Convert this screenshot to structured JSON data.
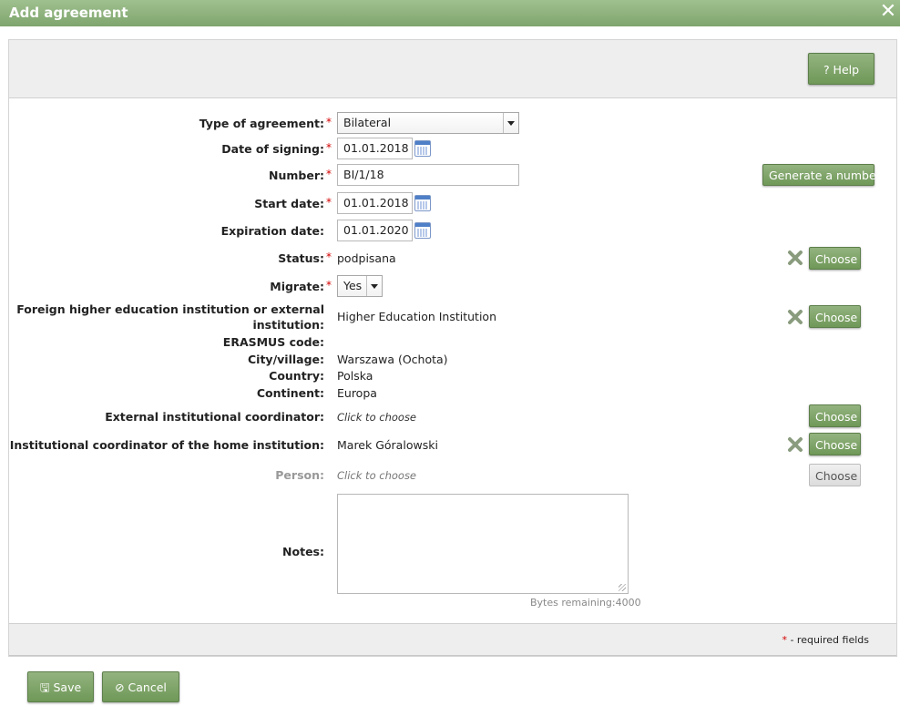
{
  "dialog": {
    "title": "Add agreement",
    "close_icon": "close-icon"
  },
  "toolbar": {
    "help_label": "? Help"
  },
  "fields": {
    "type_of_agreement": {
      "label": "Type of agreement:",
      "value": "Bilateral"
    },
    "date_of_signing": {
      "label": "Date of signing:",
      "value": "01.01.2018"
    },
    "number": {
      "label": "Number:",
      "value": "BI/1/18",
      "generate_label": "Generate a number"
    },
    "start_date": {
      "label": "Start date:",
      "value": "01.01.2018"
    },
    "expiration_date": {
      "label": "Expiration date:",
      "value": "01.01.2020"
    },
    "status": {
      "label": "Status:",
      "value": "podpisana",
      "choose_label": "Choose"
    },
    "migrate": {
      "label": "Migrate:",
      "value": "Yes"
    },
    "foreign_institution": {
      "label_line1": "Foreign higher education institution or external",
      "label_line2": "institution:",
      "value": "Higher Education Institution",
      "choose_label": "Choose"
    },
    "erasmus_code": {
      "label": "ERASMUS code:",
      "value": ""
    },
    "city": {
      "label": "City/village:",
      "value": "Warszawa (Ochota)"
    },
    "country": {
      "label": "Country:",
      "value": "Polska"
    },
    "continent": {
      "label": "Continent:",
      "value": "Europa"
    },
    "external_coordinator": {
      "label": "External institutional coordinator:",
      "value": "Click to choose",
      "choose_label": "Choose"
    },
    "home_coordinator": {
      "label": "Institutional coordinator of the home institution:",
      "value": "Marek Góralowski",
      "choose_label": "Choose"
    },
    "person": {
      "label": "Person:",
      "value": "Click to choose",
      "choose_label": "Choose"
    },
    "notes": {
      "label": "Notes:",
      "value": "",
      "bytes_remaining": "Bytes remaining:4000"
    }
  },
  "required_marker": "*",
  "required_note": "- required fields",
  "footer": {
    "save_label": "Save",
    "cancel_label": "Cancel"
  },
  "colors": {
    "accent_green": "#7fa56d",
    "required_red": "#d40000"
  }
}
